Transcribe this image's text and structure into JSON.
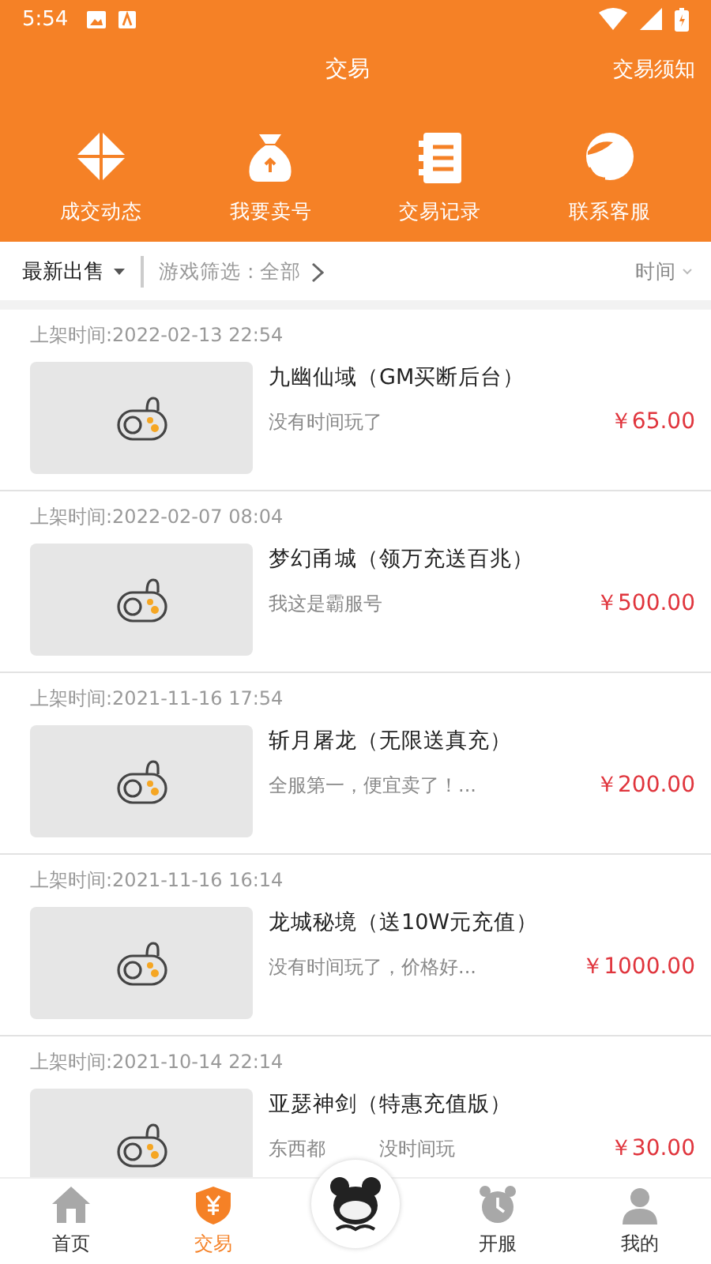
{
  "status_bar": {
    "time": "5:54"
  },
  "header": {
    "title": "交易",
    "action": "交易须知"
  },
  "shortcuts": [
    {
      "kind": "deals",
      "label": "成交动态"
    },
    {
      "kind": "sell",
      "label": "我要卖号"
    },
    {
      "kind": "records",
      "label": "交易记录"
    },
    {
      "kind": "service",
      "label": "联系客服"
    }
  ],
  "filter_bar": {
    "sort": "最新出售",
    "game_filter": "游戏筛选 : 全部",
    "order": "时间"
  },
  "listings": [
    {
      "listed": "上架时间:2022-02-13 22:54",
      "title": "九幽仙域（GM买断后台）",
      "desc": [
        "没有时间玩了"
      ],
      "price": "￥65.00"
    },
    {
      "listed": "上架时间:2022-02-07 08:04",
      "title": "梦幻甬城（领万充送百兆）",
      "desc": [
        "我这是霸服号"
      ],
      "price": "￥500.00"
    },
    {
      "listed": "上架时间:2021-11-16 17:54",
      "title": "斩月屠龙（无限送真充）",
      "desc": [
        "全服第一，便宜卖了！..."
      ],
      "price": "￥200.00"
    },
    {
      "listed": "上架时间:2021-11-16 16:14",
      "title": "龙城秘境（送10W元充值）",
      "desc": [
        "没有时间玩了，价格好..."
      ],
      "price": "￥1000.00"
    },
    {
      "listed": "上架时间:2021-10-14 22:14",
      "title": "亚瑟神剑（特惠充值版）",
      "desc": [
        "东西都",
        "没时间玩"
      ],
      "price": "￥30.00"
    }
  ],
  "nav": [
    {
      "kind": "home",
      "label": "首页",
      "selected": false
    },
    {
      "kind": "trade",
      "label": "交易",
      "selected": true
    },
    {
      "kind": "logo"
    },
    {
      "kind": "servers",
      "label": "开服",
      "selected": false
    },
    {
      "kind": "me",
      "label": "我的",
      "selected": false
    }
  ]
}
